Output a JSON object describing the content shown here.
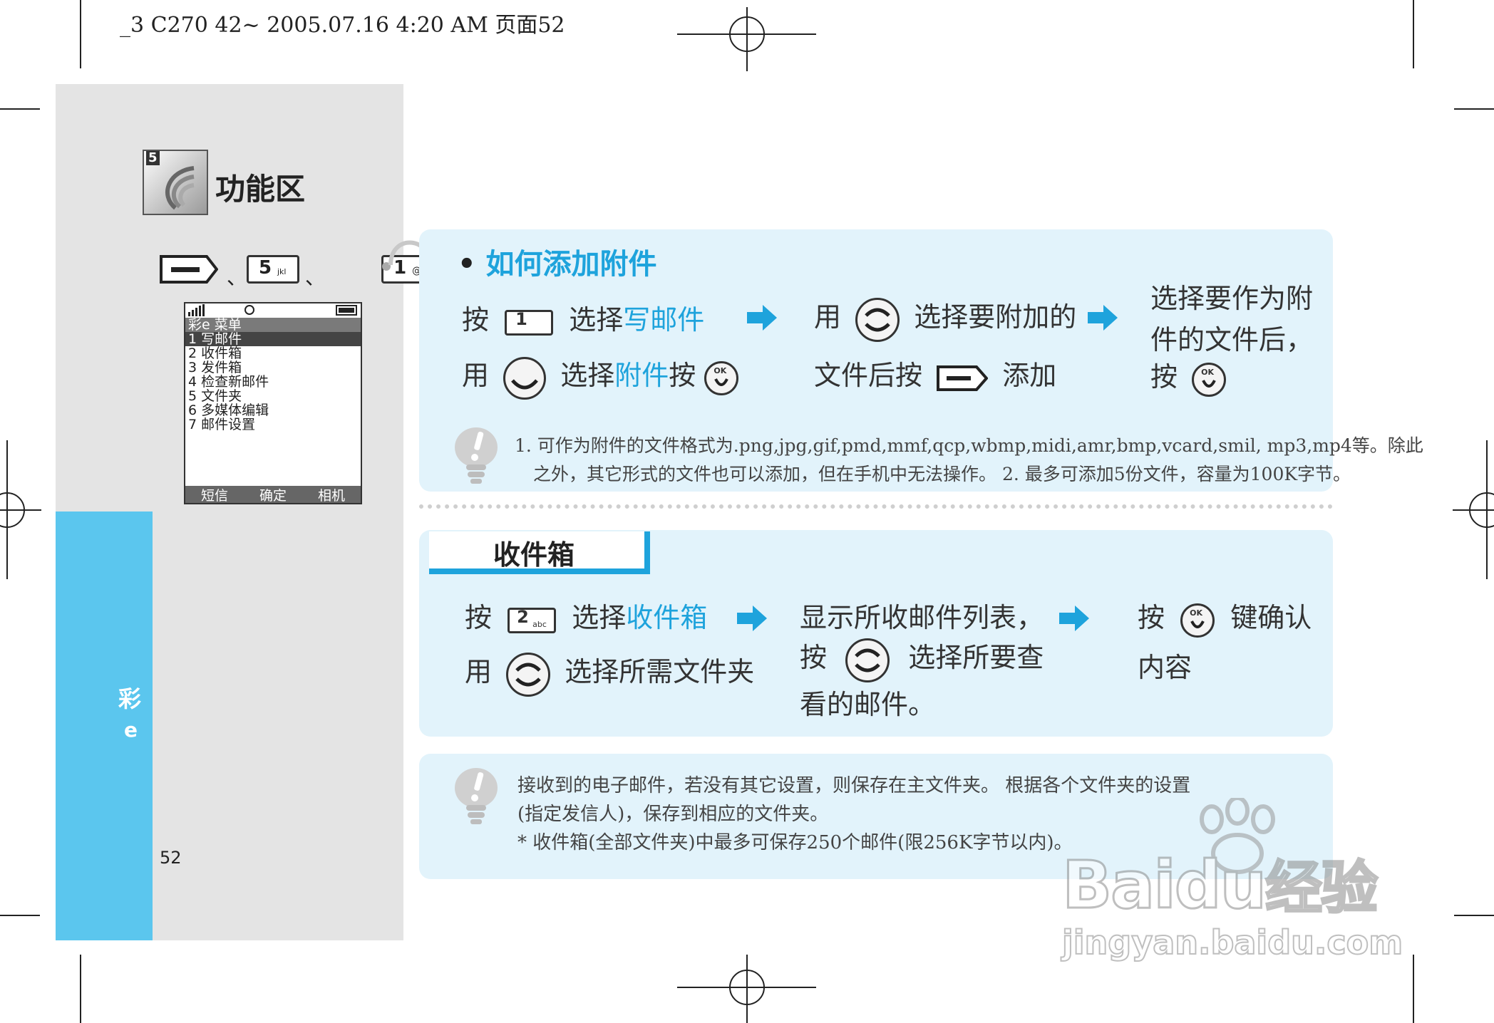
{
  "header": {
    "print_line": "_3 C270 42~  2005.07.16  4:20  AM   页面52"
  },
  "section": {
    "title": "功能区",
    "icon_number": "5"
  },
  "key_sequence": {
    "separator": "、",
    "key1_label": "5",
    "key1_sub": "jkl",
    "key2_label": "1",
    "key2_sub": "@"
  },
  "phone": {
    "title": "彩e 菜单",
    "items": [
      "1 写邮件",
      "2 收件箱",
      "3 发件箱",
      "4 检查新邮件",
      "5 文件夹",
      "6 多媒体编辑",
      "7 邮件设置"
    ],
    "softkeys": [
      "短信",
      "确定",
      "相机"
    ]
  },
  "side_tab": {
    "label_top": "彩",
    "label_bottom": "e"
  },
  "page_number": "52",
  "attach": {
    "bullet": "•",
    "title": "如何添加附件",
    "s1_press": "按",
    "s1_key": "1",
    "s1_select": "选择",
    "s1_target": "写邮件",
    "s2_use": "用",
    "s2_select": "选择",
    "s2_target": "附件",
    "s2_press": "按",
    "s3_use": "用",
    "s3_text": "选择要附加的",
    "s3_line2a": "文件后按",
    "s3_line2b": "添加",
    "s4_line1": "选择要作为附",
    "s4_line2": "件的文件后，",
    "s4_line3": "按",
    "note_line1": "1. 可作为附件的文件格式为.png,jpg,gif,pmd,mmf,qcp,wbmp,midi,amr,bmp,vcard,smil,  mp3,mp4等。除此",
    "note_line2": "之外，其它形式的文件也可以添加，但在手机中无法操作。  2. 最多可添加5份文件，容量为100K字节。"
  },
  "inbox": {
    "title": "收件箱",
    "s1_press": "按",
    "s1_key": "2",
    "s1_key_sub": "abc",
    "s1_select": "选择",
    "s1_target": "收件箱",
    "s2_use": "用",
    "s2_text": "选择所需文件夹",
    "s3_line1": "显示所收邮件列表，",
    "s3_press": "按",
    "s3_text": "选择所要查",
    "s3_line3": "看的邮件。",
    "s4_press": "按",
    "s4_text": "键确认",
    "s4_line2": "内容"
  },
  "bottom_note": {
    "line1": "接收到的电子邮件，若没有其它设置，则保存在主文件夹。  根据各个文件夹的设置",
    "line2": "(指定发信人)，保存到相应的文件夹。",
    "line3": "*  收件箱(全部文件夹)中最多可保存250个邮件(限256K字节以内)。"
  },
  "watermark": {
    "brand_a": "Bai",
    "brand_b": "du",
    "brand_cn": "经验",
    "url": "jingyan.baidu.com"
  },
  "ok_label": "OK",
  "colors": {
    "accent_blue": "#1ea3dc",
    "panel_bg": "#e2f3fb",
    "sidebar_gray": "#e4e4e4",
    "tab_blue": "#5bc6ee"
  }
}
